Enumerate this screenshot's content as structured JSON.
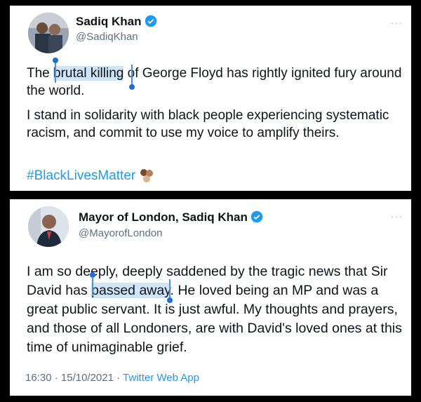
{
  "tweet1": {
    "display_name": "Sadiq Khan",
    "handle": "@SadiqKhan",
    "line1_before": "The ",
    "line1_highlight": "brutal killing",
    "line1_after": " of George Floyd has rightly ignited fury around the world.",
    "paragraph2": "I stand in solidarity with black people experiencing systematic racism, and commit to use my voice to amplify theirs.",
    "hashtag": "#BlackLivesMatter"
  },
  "tweet2": {
    "display_name": "Mayor of London, Sadiq Khan",
    "handle": "@MayorofLondon",
    "text_before": "I am so deeply, deeply saddened by the tragic news that Sir David has ",
    "text_highlight": "passed away",
    "text_after": ". He loved being an MP and was a great public servant. It is just awful. My thoughts and prayers, and those of all Londoners, are with David's loved ones at this time of unimaginable grief.",
    "time": "16:30",
    "date": "15/10/2021",
    "separator": "·",
    "app": "Twitter Web App"
  },
  "colors": {
    "verified": "#1d9bf0",
    "highlight": "#cfe4f7",
    "link": "#1d9bf0"
  }
}
